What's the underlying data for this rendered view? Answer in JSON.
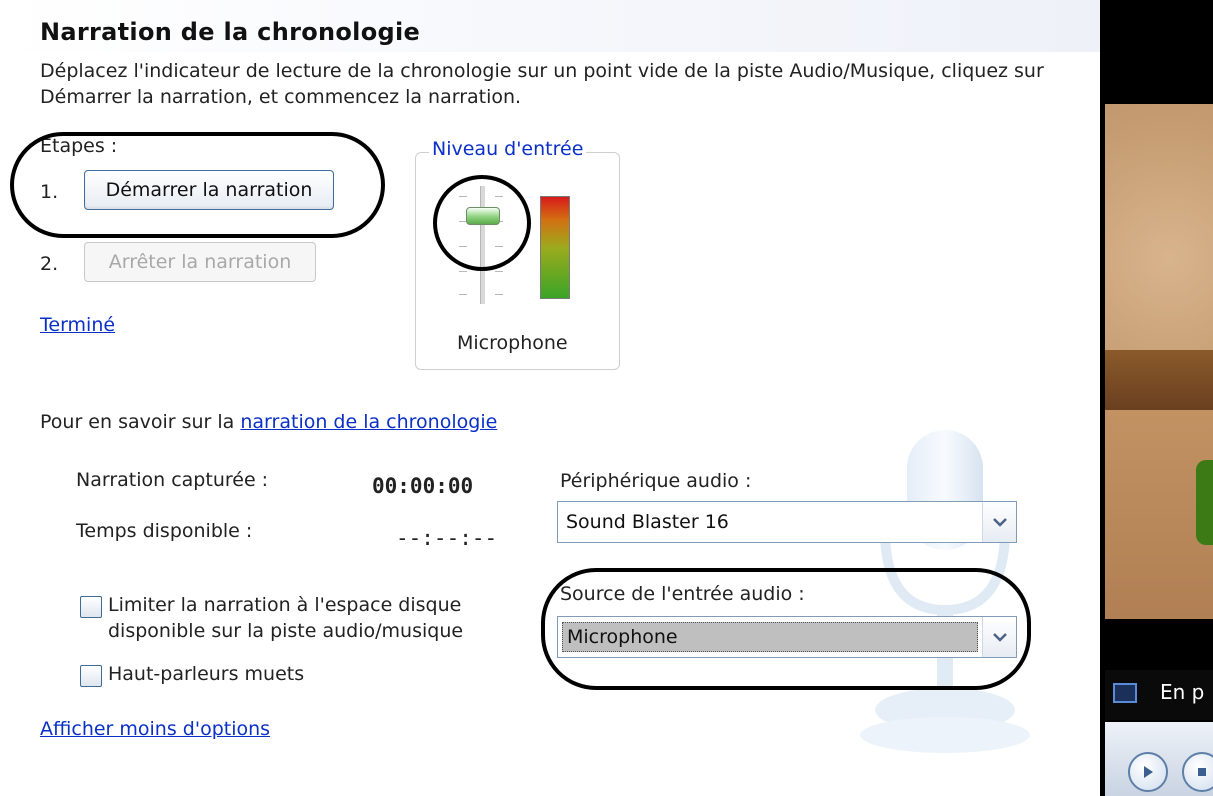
{
  "header": {
    "title": "Narration de la chronologie",
    "description": "Déplacez l'indicateur de lecture de la chronologie sur un point vide de la piste Audio/Musique, cliquez sur Démarrer la narration, et commencez la narration."
  },
  "steps": {
    "label": "Étapes :",
    "items": [
      {
        "number": "1.",
        "button_label": "Démarrer la narration",
        "enabled": true
      },
      {
        "number": "2.",
        "button_label": "Arrêter la narration",
        "enabled": false
      }
    ],
    "done_link": "Terminé"
  },
  "input_level": {
    "title": "Niveau d'entrée",
    "device_label": "Microphone",
    "slider_level": 0.8,
    "meter_colors": [
      "#d81a1a",
      "#d36f12",
      "#9cab1d",
      "#3aa427"
    ]
  },
  "learn_more": {
    "prefix": "Pour en savoir sur la ",
    "link": "narration de la chronologie"
  },
  "narration_stats": {
    "captured_label": "Narration capturée :",
    "captured_value": "00:00:00",
    "available_label": "Temps disponible :",
    "available_value": "--:--:--"
  },
  "options": {
    "limit_checkbox_line1": "Limiter la narration à l'espace disque",
    "limit_checkbox_line2": "disponible sur la piste audio/musique",
    "limit_checked": false,
    "mute_checkbox": "Haut-parleurs muets",
    "mute_checked": false,
    "toggle_link": "Afficher moins d'options"
  },
  "audio": {
    "device_label": "Périphérique audio :",
    "device_value": "Sound Blaster 16",
    "source_label": "Source de l'entrée audio :",
    "source_value": "Microphone"
  },
  "preview": {
    "status_text": "En p"
  },
  "icons": [
    "chevron-down-icon",
    "microphone-icon",
    "play-icon",
    "stop-icon",
    "display-mode-icon"
  ]
}
